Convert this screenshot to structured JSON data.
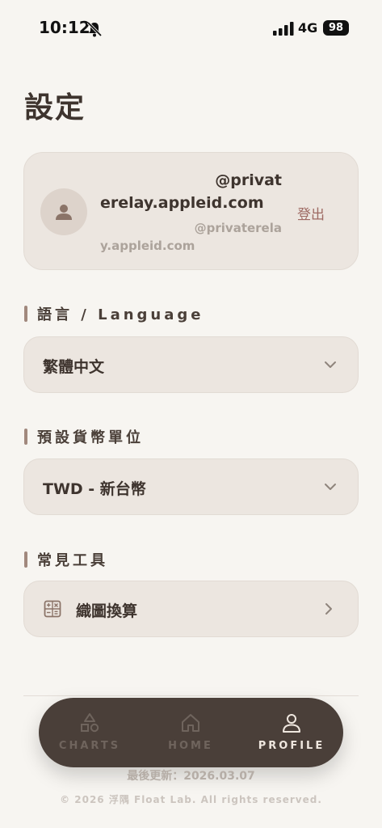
{
  "status_bar": {
    "time": "10:12",
    "network": "4G",
    "battery": "98"
  },
  "page": {
    "title": "設定"
  },
  "account": {
    "name_line1": "@privat",
    "name_line2": "erelay.appleid.com",
    "email_line1": "@privaterela",
    "email_line2": "y.appleid.com",
    "logout_label": "登出"
  },
  "language": {
    "label": "語言 / Language",
    "selected": "繁體中文"
  },
  "currency": {
    "label": "預設貨幣單位",
    "selected": "TWD - 新台幣"
  },
  "tools": {
    "label": "常見工具",
    "items": [
      {
        "label": "織圖換算",
        "icon": "calculator-icon"
      }
    ]
  },
  "bottom_nav": {
    "items": [
      {
        "label": "CHARTS",
        "icon": "shapes-icon",
        "active": false
      },
      {
        "label": "HOME",
        "icon": "home-icon",
        "active": false
      },
      {
        "label": "PROFILE",
        "icon": "user-icon",
        "active": true
      }
    ]
  },
  "footer": {
    "updated": "最後更新：2026.03.07",
    "copyright": "© 2026 浮隅 Float Lab. All rights reserved."
  },
  "colors": {
    "background": "#f7f5f1",
    "card": "#ece6e0",
    "accent": "#a1887d",
    "logout": "#9e6a63",
    "nav_bg": "#4a3f39"
  }
}
